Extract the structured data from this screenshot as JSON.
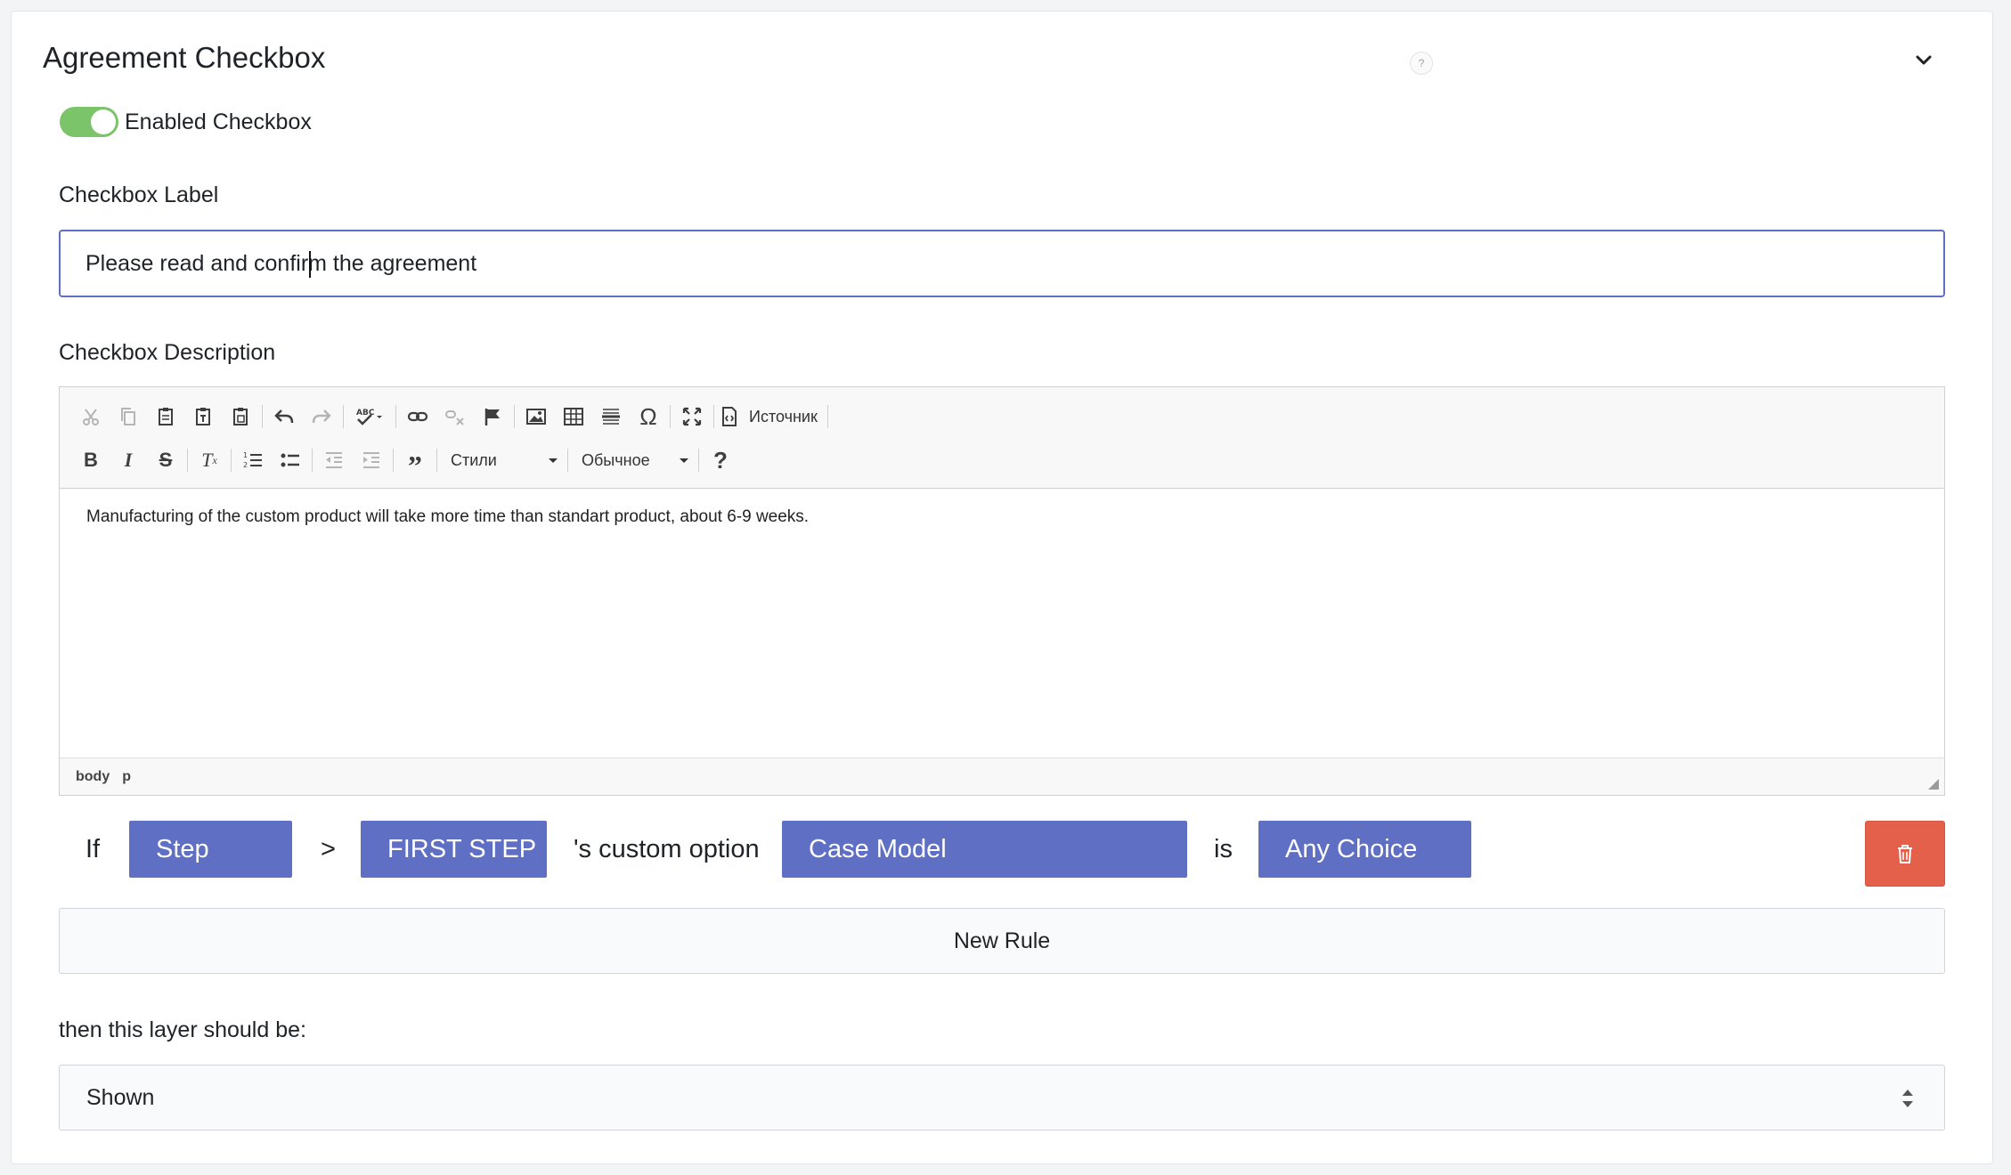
{
  "section": {
    "title": "Agreement Checkbox",
    "help_mark": "?"
  },
  "toggle": {
    "label": "Enabled Checkbox",
    "enabled": true
  },
  "checkbox_label": {
    "label": "Checkbox Label",
    "value": "Please read and confirm the agreement"
  },
  "checkbox_description": {
    "label": "Checkbox Description",
    "toolbar": {
      "source_label": "Источник",
      "styles_label": "Стили",
      "format_label": "Обычное",
      "help_label": "?"
    },
    "content": "Manufacturing of the custom product will take more time than standart product, about 6-9 weeks.",
    "path": [
      "body",
      "p"
    ]
  },
  "rule": {
    "if_word": "If",
    "step": "Step",
    "gt": ">",
    "step_value": "FIRST STEP",
    "custom_option_text": "'s custom option",
    "option": "Case Model",
    "is_word": "is",
    "choice": "Any Choice"
  },
  "new_rule_label": "New Rule",
  "then_label": "then this layer should be:",
  "visibility": {
    "selected": "Shown"
  },
  "colors": {
    "accent": "#5f6fc4",
    "toggle_on": "#7bc46a",
    "danger": "#e5604a"
  }
}
